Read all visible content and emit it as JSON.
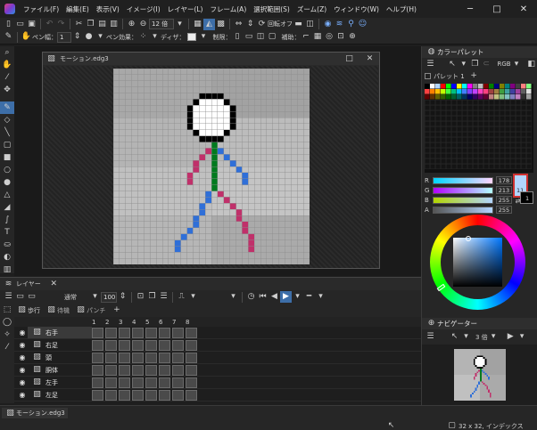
{
  "app": {
    "menu": [
      "ファイル(F)",
      "編集(E)",
      "表示(V)",
      "イメージ(I)",
      "レイヤー(L)",
      "フレーム(A)",
      "選択範囲(S)",
      "ズーム(Z)",
      "ウィンドウ(W)",
      "ヘルプ(H)"
    ],
    "zoom": "12 倍",
    "rotate_label": "回転オフ"
  },
  "toolbar2": {
    "pen_width_label": "ペン幅：",
    "pen_width": "1",
    "pen_effect_label": "ペン効果：",
    "dither_label": "ディザ：",
    "limit_label": "制限：",
    "assist_label": "補助："
  },
  "document": {
    "title": "モーション.edg3"
  },
  "layer_panel": {
    "title": "レイヤー",
    "blend_mode": "通常",
    "opacity": "100",
    "tabs": [
      "歩行",
      "待機",
      "パンチ"
    ],
    "frames": [
      "1",
      "2",
      "3",
      "4",
      "5",
      "6",
      "7",
      "8"
    ],
    "layers": [
      "右手",
      "右足",
      "頭",
      "胴体",
      "左手",
      "左足"
    ],
    "selected_layer": 0
  },
  "color_panel": {
    "title": "カラーパレット",
    "palette_name": "パレット 1",
    "color_mode": "RGB",
    "channels": [
      {
        "label": "R",
        "value": "178"
      },
      {
        "label": "G",
        "value": "213"
      },
      {
        "label": "B",
        "value": "255"
      },
      {
        "label": "A",
        "value": "255"
      }
    ],
    "fg_index": "11",
    "bg_index": "1",
    "fg_color": "#b2d5ff",
    "bg_color": "#000000",
    "accent": "#3d6ea8"
  },
  "navigator": {
    "title": "ナビゲーター",
    "zoom": "3 倍"
  },
  "status": {
    "doc_tab": "モーション.edg3",
    "info": "32 x 32, インデックス"
  }
}
